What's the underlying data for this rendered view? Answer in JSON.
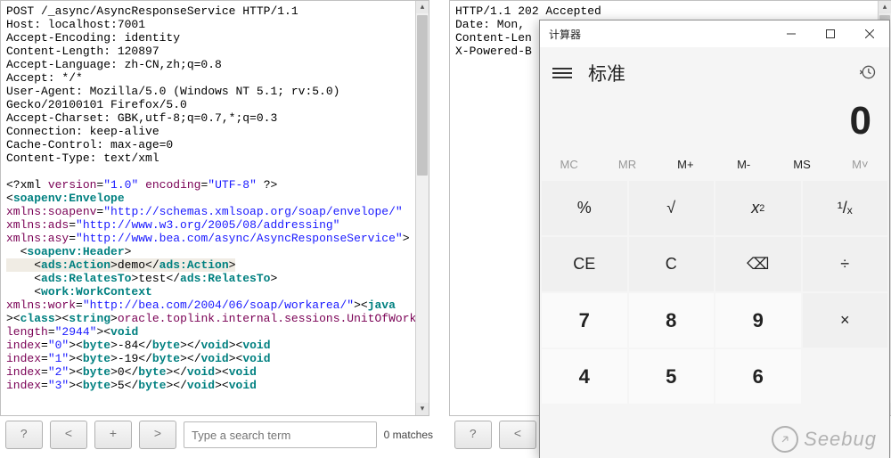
{
  "request_raw": "POST /_async/AsyncResponseService HTTP/1.1\nHost: localhost:7001\nAccept-Encoding: identity\nContent-Length: 120897\nAccept-Language: zh-CN,zh;q=0.8\nAccept: */*\nUser-Agent: Mozilla/5.0 (Windows NT 5.1; rv:5.0)\nGecko/20100101 Firefox/5.0\nAccept-Charset: GBK,utf-8;q=0.7,*;q=0.3\nConnection: keep-alive\nCache-Control: max-age=0\nContent-Type: text/xml\n",
  "xml": {
    "decl": {
      "version": "1.0",
      "encoding": "UTF-8"
    },
    "envelope_ns": {
      "soapenv": "http://schemas.xmlsoap.org/soap/envelope/",
      "ads": "http://www.w3.org/2005/08/addressing",
      "asy": "http://www.bea.com/async/AsyncResponseService",
      "work": "http://bea.com/2004/06/soap/workarea/"
    },
    "action_text": "demo",
    "relatesto_text": "test",
    "java_class_string": "oracle.toplink.internal.sessions.UnitOfWorkChangeSet",
    "array_class": "byte",
    "array_length": "2944",
    "bytes": [
      {
        "index": "0",
        "val": "-84"
      },
      {
        "index": "1",
        "val": "-19"
      },
      {
        "index": "2",
        "val": "0"
      },
      {
        "index": "3",
        "val": "5"
      }
    ]
  },
  "response_raw": "HTTP/1.1 202 Accepted\nDate: Mon,\nContent-Len\nX-Powered-B",
  "toolbar": {
    "btn_help": "?",
    "btn_prev": "<",
    "btn_add": "+",
    "btn_next": ">",
    "search_placeholder": "Type a search term",
    "matches": "0 matches"
  },
  "calc": {
    "title": "计算器",
    "mode": "标准",
    "display": "0",
    "memory": [
      "MC",
      "MR",
      "M+",
      "M-",
      "MS",
      "M˅"
    ],
    "memory_active": [
      false,
      false,
      true,
      true,
      true,
      false
    ],
    "keys": [
      {
        "t": "%",
        "c": "fn"
      },
      {
        "t": "√",
        "c": "fn"
      },
      {
        "t": "x²",
        "c": "fn",
        "sup": true
      },
      {
        "t": "¹/ₓ",
        "c": "fn"
      },
      {
        "t": "CE",
        "c": "fn"
      },
      {
        "t": "C",
        "c": "fn"
      },
      {
        "t": "⌫",
        "c": "fn"
      },
      {
        "t": "÷",
        "c": "fn"
      },
      {
        "t": "7",
        "c": "num"
      },
      {
        "t": "8",
        "c": "num"
      },
      {
        "t": "9",
        "c": "num"
      },
      {
        "t": "×",
        "c": "fn"
      },
      {
        "t": "4",
        "c": "num"
      },
      {
        "t": "5",
        "c": "num"
      },
      {
        "t": "6",
        "c": "num"
      }
    ]
  },
  "watermark": "Seebug"
}
